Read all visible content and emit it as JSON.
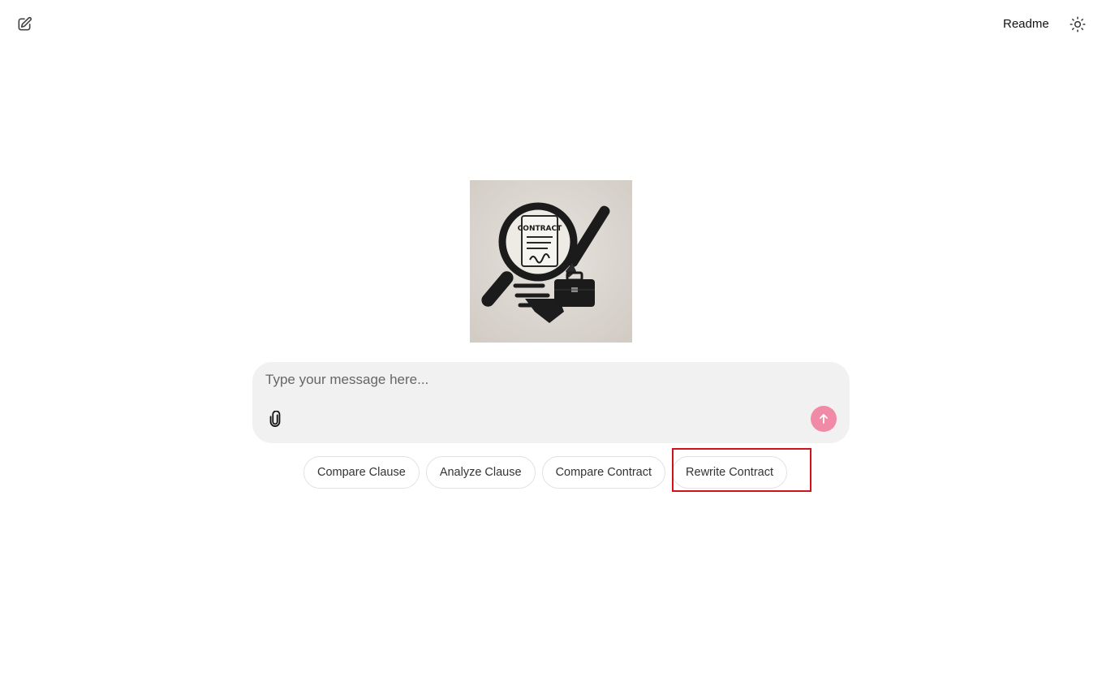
{
  "header": {
    "new_chat_icon": "edit-square-icon",
    "readme_label": "Readme",
    "theme_icon": "sun-icon"
  },
  "hero": {
    "logo_text": "CONTRACT"
  },
  "composer": {
    "placeholder": "Type your message here...",
    "value": "",
    "attach_icon": "paperclip-icon",
    "send_icon": "arrow-up-icon"
  },
  "suggestions": [
    {
      "label": "Compare Clause"
    },
    {
      "label": "Analyze Clause"
    },
    {
      "label": "Compare Contract"
    },
    {
      "label": "Rewrite Contract"
    }
  ],
  "colors": {
    "send_button": "#f18aa6",
    "composer_bg": "#f1f1f1",
    "highlight": "#d4101a"
  }
}
